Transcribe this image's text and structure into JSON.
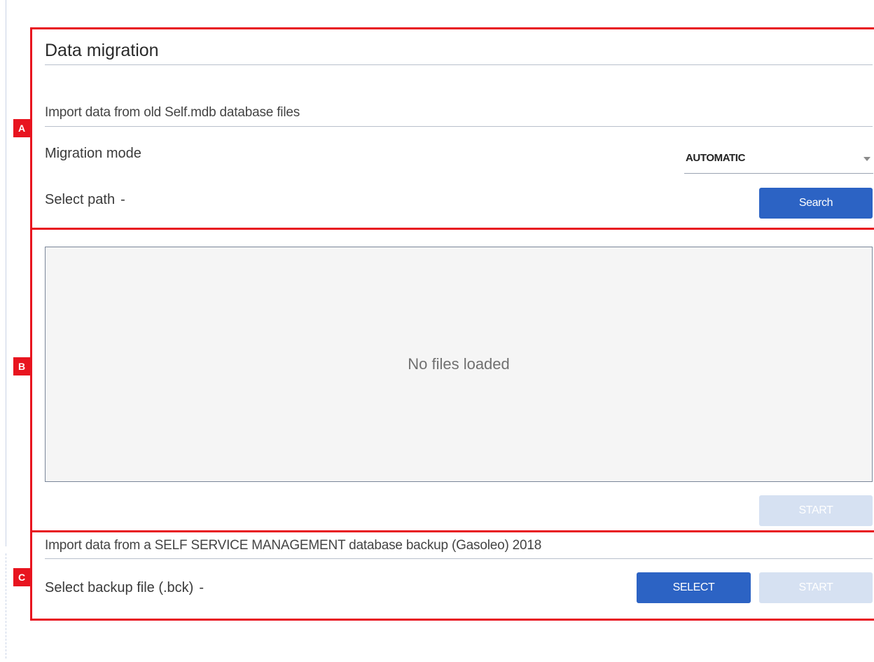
{
  "page": {
    "title": "Data migration"
  },
  "section_a": {
    "marker": "A",
    "subtitle": "Import data from old Self.mdb database files",
    "migration_mode_label": "Migration mode",
    "migration_mode_value": "AUTOMATIC",
    "select_path_label": "Select path",
    "select_path_value": "-",
    "search_button": "Search"
  },
  "section_b": {
    "marker": "B",
    "empty_message": "No files loaded",
    "start_button": "START"
  },
  "section_c": {
    "marker": "C",
    "subtitle": "Import data from a SELF SERVICE MANAGEMENT database backup (Gasoleo) 2018",
    "select_backup_label": "Select backup file (.bck)",
    "select_backup_value": "-",
    "select_button": "SELECT",
    "start_button": "START"
  },
  "colors": {
    "primary": "#2c63c4",
    "disabled": "#d6e1f2",
    "annotation": "#e8141f"
  },
  "icons": {
    "dropdown": "chevron-down-icon"
  }
}
